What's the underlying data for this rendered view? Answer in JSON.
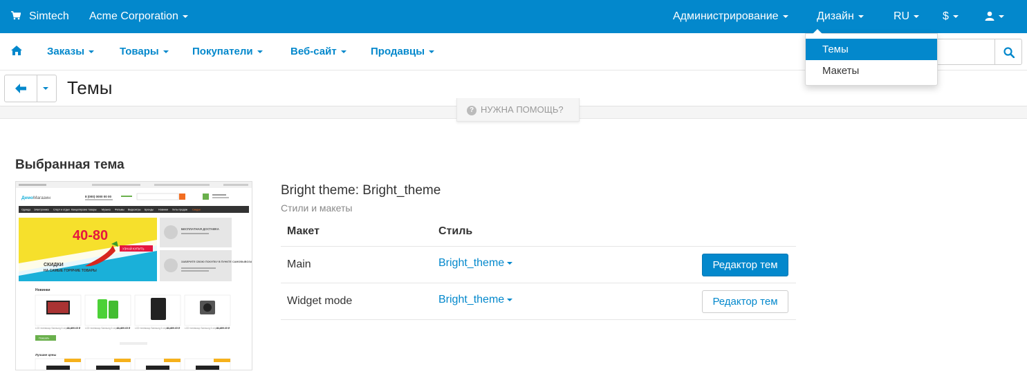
{
  "topbar": {
    "brand": "Simtech",
    "company": "Acme Corporation",
    "menu_admin": "Администрирование",
    "menu_design": "Дизайн",
    "menu_lang": "RU",
    "menu_currency": "$"
  },
  "navbar": {
    "items": [
      "Заказы",
      "Товары",
      "Покупатели",
      "Веб-сайт",
      "Продавцы"
    ]
  },
  "design_dropdown": {
    "items": [
      "Темы",
      "Макеты"
    ],
    "active_index": 0
  },
  "header": {
    "title": "Темы",
    "help_label": "НУЖНА ПОМОЩЬ?"
  },
  "content": {
    "section_title": "Выбранная тема",
    "theme_name": "Bright theme: Bright_theme",
    "theme_subtitle": "Стили и макеты",
    "table": {
      "col_layout": "Макет",
      "col_style": "Стиль",
      "rows": [
        {
          "layout": "Main",
          "style": "Bright_theme",
          "button": "Редактор тем"
        },
        {
          "layout": "Widget mode",
          "style": "Bright_theme",
          "button": "Редактор тем"
        }
      ]
    }
  },
  "preview": {
    "shop_name_a": "Демо",
    "shop_name_b": "Магазин",
    "phone": "8 (000) 0000 00 00",
    "banner_text": "40-80",
    "banner_btn": "УЗНАЙ КУПИТЬ",
    "banner_sub1": "СКИДКИ",
    "banner_sub2": "НА САМЫЕ ГОРЯЧИЕ ТОВАРЫ",
    "promo1": "БЕСПЛАТНАЯ ДОСТАВКА",
    "promo2": "ЗАБЕРИТЕ СВОЮ ПОКУПКУ В ПУНКТЕ САМОВЫВОЗА",
    "new_label": "Новинки",
    "best_label": "Лучшие цены",
    "show_btn": "Показать",
    "menu": [
      "Одежда",
      "Электроника",
      "Спорт и отдых",
      "Канцелярские товары",
      "Музыка",
      "Фильмы",
      "Видеоигры",
      "Бренды",
      "Новинки",
      "Хиты продаж",
      "Скидки"
    ],
    "prices": [
      "31,499.65 ₽",
      "31,499.65 ₽",
      "31,499.65 ₽",
      "31,499.65 ₽"
    ],
    "product_caption": "LCD телевизор Samsung 6 серии 46"
  },
  "colors": {
    "primary": "#0388cc",
    "banner_yellow": "#f6e02c",
    "banner_cyan": "#1ab0d9",
    "banner_red": "#e5173f"
  }
}
